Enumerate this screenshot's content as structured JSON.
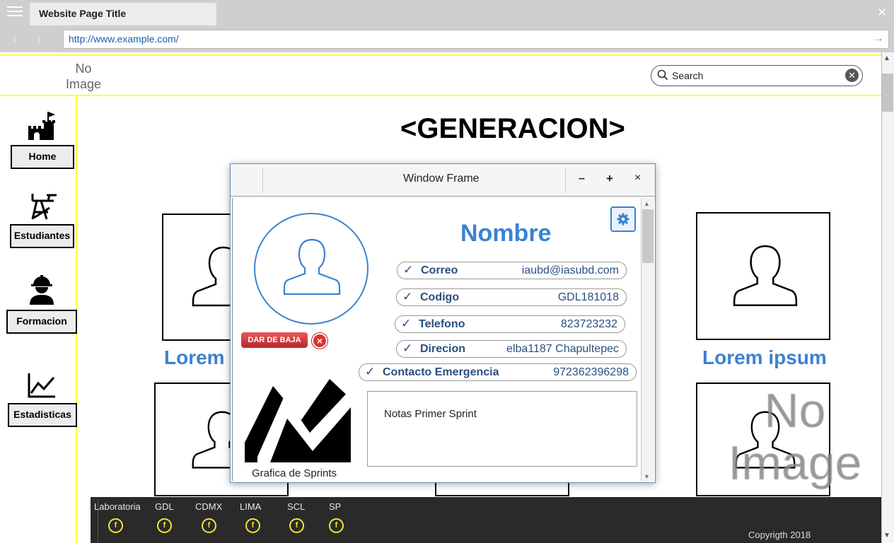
{
  "browser": {
    "tab_title": "Website Page Title",
    "url": "http://www.example.com/",
    "close_glyph": "✕",
    "back_glyph": "‹",
    "forward_glyph": "›",
    "go_glyph": "→"
  },
  "header": {
    "logo_text": "No Image",
    "search_placeholder": "Search",
    "search_clear_glyph": "✕"
  },
  "sidebar": {
    "items": [
      {
        "label": "Home",
        "icon": "castle-icon"
      },
      {
        "label": "Estudiantes",
        "icon": "desk-chair-icon"
      },
      {
        "label": "Formacion",
        "icon": "worker-icon"
      },
      {
        "label": "Estadisticas",
        "icon": "line-chart-icon"
      }
    ]
  },
  "main": {
    "heading": "<GENERACION>",
    "card_labels": [
      "Lorem",
      "Lorem ipsum"
    ],
    "no_image_text": "No Image"
  },
  "footer": {
    "items": [
      "Laboratoria",
      "GDL",
      "CDMX",
      "LIMA",
      "SCL",
      "SP"
    ],
    "icon_glyph": "f",
    "copyright": "Copyrigth 2018"
  },
  "modal": {
    "title": "Window Frame",
    "minimize": "–",
    "maximize": "+",
    "close": "×",
    "name": "Nombre",
    "fields": [
      {
        "label": "Correo",
        "value": "iaubd@iasubd.com"
      },
      {
        "label": "Codigo",
        "value": "GDL181018"
      },
      {
        "label": "Telefono",
        "value": "823723232"
      },
      {
        "label": "Direcion",
        "value": "elba1187 Chapultepec"
      },
      {
        "label": "Contacto Emergencia",
        "value": "972362396298"
      }
    ],
    "check_glyph": "✓",
    "dar_baja_label": "DAR DE BAJA",
    "dar_baja_x": "×",
    "chart_label": "Grafica de Sprints",
    "notes_text": "Notas Primer Sprint"
  },
  "colors": {
    "accent": "#3b82d1",
    "highlight_line": "#ffff33",
    "footer_bg": "#2a2a2a",
    "footer_icon": "#f4e53a",
    "danger": "#d9342b"
  }
}
